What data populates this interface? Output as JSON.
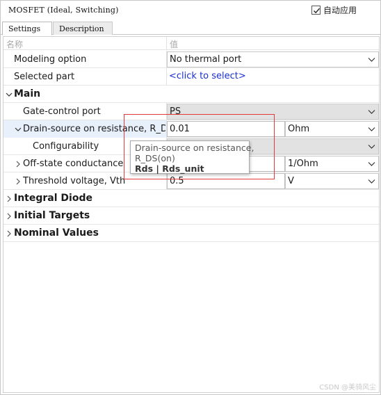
{
  "window": {
    "title": "MOSFET (Ideal, Switching)",
    "auto_apply_label": "自动应用",
    "auto_apply_checked": true
  },
  "tabs": [
    {
      "label": "Settings",
      "active": true
    },
    {
      "label": "Description",
      "active": false
    }
  ],
  "grid": {
    "header_name": "名称",
    "header_value": "值",
    "rows": {
      "modeling_option": {
        "label": "Modeling option",
        "value": "No thermal port"
      },
      "selected_part": {
        "label": "Selected part",
        "value": "<click to select>"
      },
      "main": {
        "label": "Main"
      },
      "gate_control": {
        "label": "Gate-control port",
        "value": "PS"
      },
      "drain_source": {
        "label": "Drain-source on resistance, R_DS...",
        "value": "0.01",
        "unit": "Ohm"
      },
      "configurability": {
        "label": "Configurability",
        "value": ""
      },
      "off_state": {
        "label": "Off-state conductance",
        "value": "",
        "unit": "1/Ohm"
      },
      "threshold": {
        "label": "Threshold voltage, Vth",
        "value": "0.5",
        "unit": "V"
      },
      "integral_diode": {
        "label": "Integral Diode"
      },
      "initial_targets": {
        "label": "Initial Targets"
      },
      "nominal_values": {
        "label": "Nominal Values"
      }
    }
  },
  "tooltip": {
    "line1": "Drain-source on resistance,",
    "line2": "R_DS(on)",
    "vars": "Rds | Rds_unit"
  },
  "watermark": "CSDN @美骑风尘",
  "colors": {
    "link": "#1a2fd0",
    "highlight_box": "#e23a3a",
    "selected_row_bg": "#e8f0fb",
    "gray_dropdown_bg": "#e2e2e2"
  }
}
